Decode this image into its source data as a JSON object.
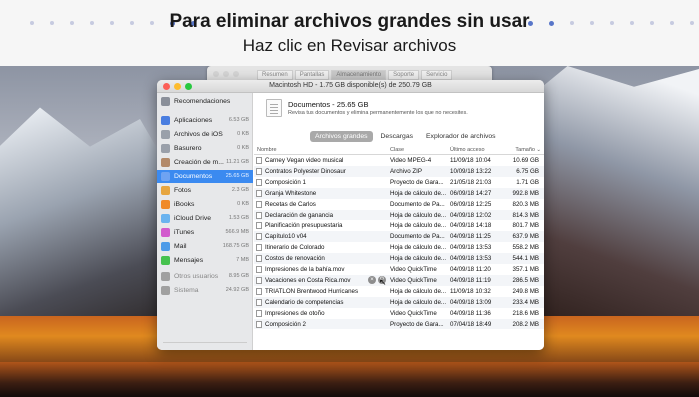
{
  "banner": {
    "headline": "Para eliminar archivos grandes sin usar",
    "subline_prefix": "Haz clic en ",
    "subline_action": "Revisar archivos"
  },
  "background_window": {
    "tabs": [
      "Resumen",
      "Pantallas",
      "Almacenamiento",
      "Soporte",
      "Servicio"
    ],
    "selected_tab": "Almacenamiento"
  },
  "window": {
    "title": "Macintosh HD - 1.75 GB disponible(s) de 250.79 GB",
    "traffic_lights": [
      "#fc5f57",
      "#fdbc2e",
      "#28c840"
    ]
  },
  "sidebar": {
    "items": [
      {
        "label": "Recomendaciones",
        "size": "",
        "color": "#8a8f99"
      },
      {
        "label": "Aplicaciones",
        "size": "6.53 GB",
        "color": "#4a7ee0"
      },
      {
        "label": "Archivos de iOS",
        "size": "0 KB",
        "color": "#9aa0aa"
      },
      {
        "label": "Basurero",
        "size": "0 KB",
        "color": "#9aa0aa"
      },
      {
        "label": "Creación de m...",
        "size": "11.21 GB",
        "color": "#b38a6a"
      },
      {
        "label": "Documentos",
        "size": "25.65 GB",
        "color": "#6ea3f2"
      },
      {
        "label": "Fotos",
        "size": "2.3 GB",
        "color": "#e7a640"
      },
      {
        "label": "iBooks",
        "size": "0 KB",
        "color": "#f08a2a"
      },
      {
        "label": "iCloud Drive",
        "size": "1.53 GB",
        "color": "#6ab3ef"
      },
      {
        "label": "iTunes",
        "size": "566.9 MB",
        "color": "#d25bcd"
      },
      {
        "label": "Mail",
        "size": "168.75 GB",
        "color": "#4d9be8"
      },
      {
        "label": "Mensajes",
        "size": "7 MB",
        "color": "#46c24e"
      },
      {
        "label": "Otros usuarios",
        "size": "8.95 GB",
        "color": "#a0a0a0"
      },
      {
        "label": "Sistema",
        "size": "24.92 GB",
        "color": "#a0a0a0"
      }
    ],
    "selected": "Documentos"
  },
  "documents": {
    "title": "Documentos - 25.65 GB",
    "description": "Revisa tus documentos y elimina permanentemente los que no necesites."
  },
  "segments": [
    "Archivos grandes",
    "Descargas",
    "Explorador de archivos"
  ],
  "selected_segment": "Archivos grandes",
  "table": {
    "columns": {
      "name": "Nombre",
      "kind": "Clase",
      "last_access": "Último acceso",
      "size": "Tamaño"
    },
    "rows": [
      {
        "name": "Carney Vegan video musical",
        "kind": "Video MPEG-4",
        "date": "11/09/18 10:04",
        "size": "10.69 GB"
      },
      {
        "name": "Contratos Polyester Dinosaur",
        "kind": "Archivo ZIP",
        "date": "10/09/18 13:22",
        "size": "6.75 GB"
      },
      {
        "name": "Composición 1",
        "kind": "Proyecto de Gara...",
        "date": "21/05/18 21:03",
        "size": "1.71 GB"
      },
      {
        "name": "Granja Whitestone",
        "kind": "Hoja de cálculo de...",
        "date": "06/09/18 14:27",
        "size": "992.8 MB"
      },
      {
        "name": "Recetas de Carlos",
        "kind": "Documento de Pa...",
        "date": "06/09/18 12:25",
        "size": "820.3 MB"
      },
      {
        "name": "Declaración de ganancia",
        "kind": "Hoja de cálculo de...",
        "date": "04/09/18 12:02",
        "size": "814.3 MB"
      },
      {
        "name": "Planificación presupuestaria",
        "kind": "Hoja de cálculo de...",
        "date": "04/09/18 14:18",
        "size": "801.7 MB"
      },
      {
        "name": "Capítulo10 v04",
        "kind": "Documento de Pa...",
        "date": "04/09/18 11:25",
        "size": "637.9 MB"
      },
      {
        "name": "Itinerario de Colorado",
        "kind": "Hoja de cálculo de...",
        "date": "04/09/18 13:53",
        "size": "558.2 MB"
      },
      {
        "name": "Costos de renovación",
        "kind": "Hoja de cálculo de...",
        "date": "04/09/18 13:53",
        "size": "544.1 MB"
      },
      {
        "name": "Impresiones de la bahía.mov",
        "kind": "Video QuickTime",
        "date": "04/09/18 11:20",
        "size": "357.1 MB"
      },
      {
        "name": "Vacaciones en Costa Rica.mov",
        "kind": "Video QuickTime",
        "date": "04/09/18 11:19",
        "size": "286.5 MB"
      },
      {
        "name": "TRIATLÓN Brentwood Hurricanes",
        "kind": "Hoja de cálculo de...",
        "date": "11/09/18 10:32",
        "size": "249.8 MB"
      },
      {
        "name": "Calendario de competencias",
        "kind": "Hoja de cálculo de...",
        "date": "04/09/18 13:09",
        "size": "233.4 MB"
      },
      {
        "name": "Impresiones de otoño",
        "kind": "Video QuickTime",
        "date": "04/09/18 11:36",
        "size": "218.6 MB"
      },
      {
        "name": "Composición 2",
        "kind": "Proyecto de Gara...",
        "date": "07/04/18 18:49",
        "size": "208.2 MB"
      }
    ],
    "hovered_row": 11,
    "row_actions": {
      "remove": "×",
      "reveal": "⚲"
    }
  }
}
